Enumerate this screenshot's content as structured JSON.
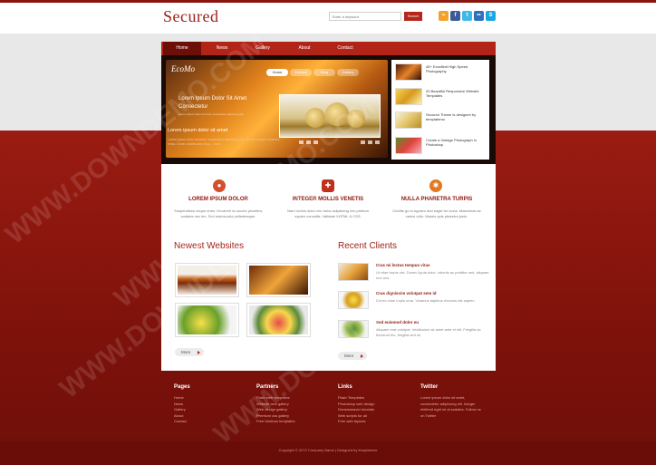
{
  "header": {
    "logo": "Secured",
    "search_placeholder": "Enter a keyword",
    "search_button": "Search",
    "social": [
      {
        "name": "rss-icon",
        "glyph": "⌁",
        "color": "#f2a22a"
      },
      {
        "name": "facebook-icon",
        "glyph": "f",
        "color": "#3b5a9a"
      },
      {
        "name": "twitter-icon",
        "glyph": "t",
        "color": "#3db8e8"
      },
      {
        "name": "flickr-icon",
        "glyph": "••",
        "color": "#2f6fbd"
      },
      {
        "name": "skype-icon",
        "glyph": "S",
        "color": "#19a7e0"
      }
    ]
  },
  "nav": [
    "Home",
    "News",
    "Gallery",
    "About",
    "Contact"
  ],
  "slider": {
    "logo": "EcoMo",
    "tabs": [
      "Home",
      "Contact",
      "Blog",
      "Gallery"
    ],
    "title": "Lorem Ipsum Dolor Sit Amet Consectetur",
    "subtitle": "Lorem ipsum dolor sit amet consectetur adipiscing elit",
    "caption": "Lorem ipsum dolor sit amet",
    "caption_text": "Lorem ipsum dolor sit amet, consectetur adipiscing elit. Mauris congue euismod tellus, Donec malesuada risus... more",
    "thumbs": [
      "45+ Excellent High Speed Photography",
      "20 Beautiful Responsive Website Templates",
      "Secured Theme is designed by templatemo",
      "Create a Vintage Photograph in Photoshop"
    ]
  },
  "features": [
    {
      "title": "LOREM IPSUM DOLOR",
      "text": "Suspendisse neque enim, hendrerit eu auctor pharetra, sodales nec leo. Sed malesuada pellentesque.",
      "icon": "circle-icon",
      "color": "#d2502c"
    },
    {
      "title": "INTEGER MOLLIS VENETIS",
      "text": "Nam lacinia dolor nec tortor adipiscing nec pretium sapien convallis. Validate XHTML & CSS.",
      "icon": "shield-icon",
      "color": "#c0301f"
    },
    {
      "title": "NULLA PHARETRA TURPIS",
      "text": "Credits go to egoism and eagle for icons. Maecenas ac varius odio. Mauris quis pharetra justo.",
      "icon": "bug-icon",
      "color": "#e07a22"
    }
  ],
  "newest": {
    "title": "Newest Websites",
    "more": "More"
  },
  "clients": {
    "title": "Recent Clients",
    "more": "More",
    "items": [
      {
        "title": "Cras mi lectus tempus vitae",
        "text": "Ut vitae turpis nisi. Donec ligula dolor, lobortis ac porttitor sed, aliquam non orci."
      },
      {
        "title": "Cras dignissim volutpat sem id",
        "text": "Donec vitae turpis urna. Vivamus dapibus rhoncus est sapien."
      },
      {
        "title": "Sed euismod dolor eu",
        "text": "Aliquam erat volutpat. Vestibulum sit amet ante et elit. Fringilla ac tincidunt leo, fringilla sed mi."
      }
    ]
  },
  "footer": {
    "pages": {
      "title": "Pages",
      "items": [
        "Home",
        "News",
        "Gallery",
        "About",
        "Contact"
      ]
    },
    "partners": {
      "title": "Partners",
      "items": [
        "Flash web templates",
        "Website web gallery",
        "Web design gallery",
        "Premium css gallery",
        "Free html/css templates"
      ]
    },
    "links": {
      "title": "Links",
      "items": [
        "Flash Templates",
        "Photoshop web design",
        "Dreamweaver tutorials",
        "Web scripts for all",
        "Free web layouts"
      ]
    },
    "twitter": {
      "title": "Twitter",
      "text": "Lorem ipsum dolor sit amet, consectetur adipiscing elit. Integer eleifend eget mi at sodales. Follow us on Twitter"
    },
    "copyright": "Copyright © 2072 Company Name | Designed by templatemo"
  },
  "watermark": "WWW.DOWNDEMO.COM"
}
